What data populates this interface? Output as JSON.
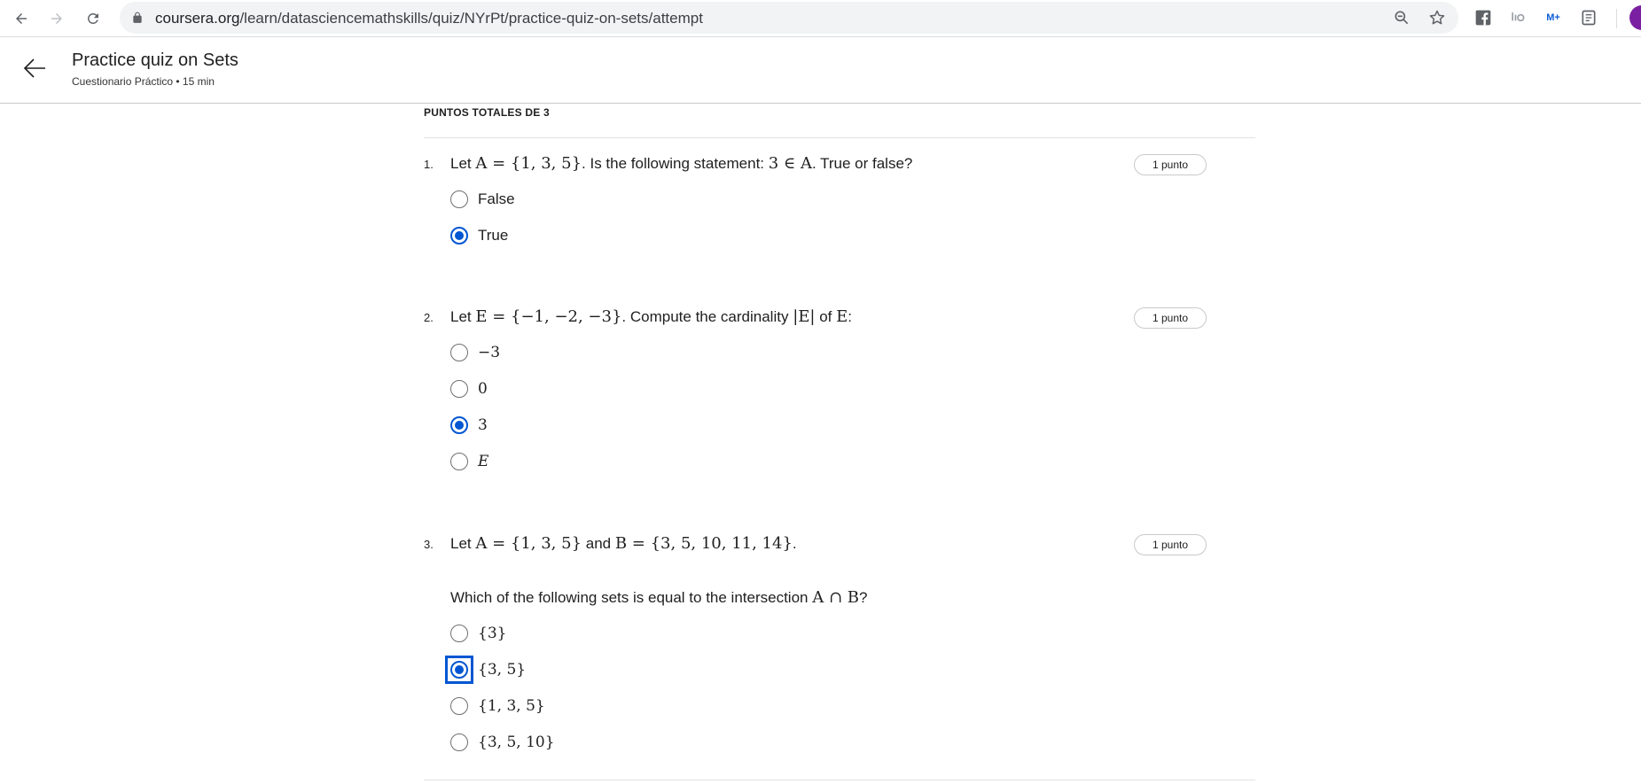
{
  "browser": {
    "url_domain": "coursera.org",
    "url_path": "/learn/datasciencemathskills/quiz/NYrPt/practice-quiz-on-sets/attempt",
    "extensions": [
      "facebook-icon",
      "music-ext-icon",
      "movistar-icon",
      "scroll-ext-icon"
    ],
    "ext_labels": {
      "movistar": "M+"
    }
  },
  "header": {
    "title": "Practice quiz on Sets",
    "subtitle": "Cuestionario Práctico • 15 min"
  },
  "quiz": {
    "total_points": "PUNTOS TOTALES DE 3",
    "questions": [
      {
        "number": "1.",
        "text_prefix": "Let ",
        "math_1": "A = {1, 3, 5}",
        "text_mid": ". Is the following statement: ",
        "math_2": "3 ∈ A",
        "text_suffix": ". True or false?",
        "points": "1 punto",
        "options": [
          {
            "label": "False",
            "checked": false
          },
          {
            "label": "True",
            "checked": true
          }
        ]
      },
      {
        "number": "2.",
        "text_prefix": "Let ",
        "math_1": "E = {−1, −2, −3}",
        "text_mid": ". Compute the cardinality ",
        "math_2": "|E|",
        "text_mid2": " of ",
        "math_3": "E",
        "text_suffix": ":",
        "points": "1 punto",
        "options": [
          {
            "label": "−3",
            "checked": false
          },
          {
            "label": "0",
            "checked": false
          },
          {
            "label": "3",
            "checked": true
          },
          {
            "label": "E",
            "checked": false
          }
        ]
      },
      {
        "number": "3.",
        "text_prefix": "Let ",
        "math_1": "A = {1, 3, 5}",
        "text_mid": " and ",
        "math_2": "B = {3, 5, 10, 11, 14}",
        "text_suffix": ".",
        "sub_prefix": "Which of the following sets is equal to the intersection ",
        "sub_math": "A ∩ B",
        "sub_suffix": "?",
        "points": "1 punto",
        "options": [
          {
            "label": "{3}",
            "checked": false
          },
          {
            "label": "{3, 5}",
            "checked": true,
            "focused": true
          },
          {
            "label": "{1, 3, 5}",
            "checked": false
          },
          {
            "label": "{3, 5, 10}",
            "checked": false
          }
        ]
      }
    ]
  },
  "colors": {
    "accent": "#0056d2",
    "profile": "#7b1fa2"
  }
}
